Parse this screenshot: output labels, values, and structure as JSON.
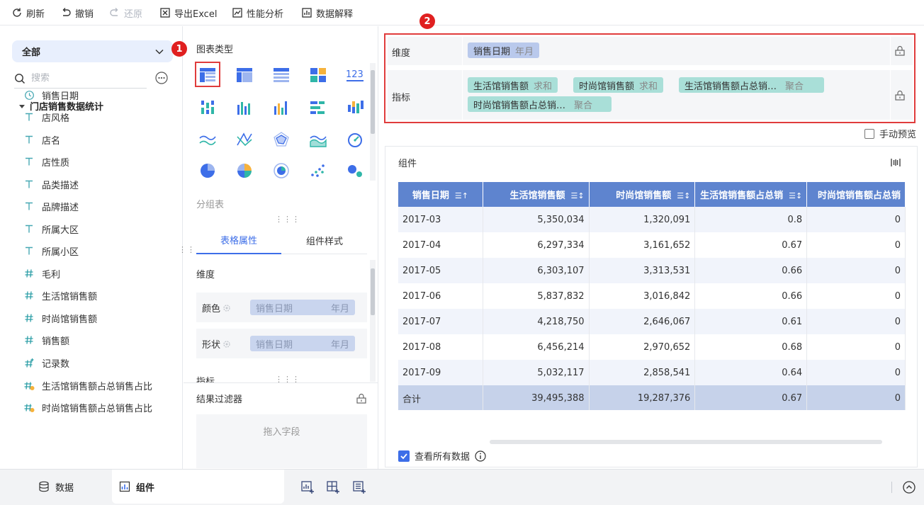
{
  "toolbar": {
    "refresh": "刷新",
    "undo": "撤销",
    "redo": "还原",
    "export_excel": "导出Excel",
    "performance": "性能分析",
    "data_explain": "数据解释"
  },
  "left": {
    "scope": "全部",
    "search_placeholder": "搜索",
    "tree_root": "门店销售数据统计",
    "fields": [
      {
        "label": "销售日期",
        "type": "date"
      },
      {
        "label": "店风格",
        "type": "text"
      },
      {
        "label": "店名",
        "type": "text"
      },
      {
        "label": "店性质",
        "type": "text"
      },
      {
        "label": "品类描述",
        "type": "text"
      },
      {
        "label": "品牌描述",
        "type": "text"
      },
      {
        "label": "所属大区",
        "type": "text"
      },
      {
        "label": "所属小区",
        "type": "text"
      },
      {
        "label": "毛利",
        "type": "number"
      },
      {
        "label": "生活馆销售额",
        "type": "number"
      },
      {
        "label": "时尚馆销售额",
        "type": "number"
      },
      {
        "label": "销售额",
        "type": "number"
      },
      {
        "label": "记录数",
        "type": "count"
      },
      {
        "label": "生活馆销售额占总销售占比",
        "type": "calc"
      },
      {
        "label": "时尚馆销售额占总销售占比",
        "type": "calc"
      }
    ]
  },
  "middle": {
    "chart_type_title": "图表类型",
    "chart_type_name": "分组表",
    "tabs": [
      "表格属性",
      "组件样式"
    ],
    "dim_label": "维度",
    "color_label": "颜色",
    "shape_label": "形状",
    "color_chip": {
      "field": "销售日期",
      "gran": "年月"
    },
    "shape_chip": {
      "field": "销售日期",
      "gran": "年月"
    },
    "metric_label": "指标",
    "filter_title": "结果过滤器",
    "filter_drop": "拖入字段"
  },
  "markers": {
    "one": "1",
    "two": "2"
  },
  "config": {
    "dim_label": "维度",
    "metric_label": "指标",
    "dim_pill": {
      "field": "销售日期",
      "agg": "年月"
    },
    "metric_pills": [
      {
        "field": "生活馆销售额",
        "agg": "求和"
      },
      {
        "field": "时尚馆销售额",
        "agg": "求和"
      },
      {
        "field": "生活馆销售额占总销…",
        "agg": "聚合"
      },
      {
        "field": "时尚馆销售额占总销…",
        "agg": "聚合"
      }
    ],
    "manual_preview": "手动预览"
  },
  "component": {
    "title": "组件",
    "headers": [
      "销售日期",
      "生活馆销售额",
      "时尚馆销售额",
      "生活馆销售额占总销",
      "时尚馆销售额占总销"
    ],
    "rows": [
      [
        "2017-03",
        "5,350,034",
        "1,320,091",
        "0.8",
        "0"
      ],
      [
        "2017-04",
        "6,297,334",
        "3,161,652",
        "0.67",
        "0"
      ],
      [
        "2017-05",
        "6,303,107",
        "3,313,531",
        "0.66",
        "0"
      ],
      [
        "2017-06",
        "5,837,832",
        "3,016,842",
        "0.66",
        "0"
      ],
      [
        "2017-07",
        "4,218,750",
        "2,646,067",
        "0.61",
        "0"
      ],
      [
        "2017-08",
        "6,456,214",
        "2,970,652",
        "0.68",
        "0"
      ],
      [
        "2017-09",
        "5,032,117",
        "2,858,541",
        "0.64",
        "0"
      ]
    ],
    "total": [
      "合计",
      "39,495,388",
      "19,287,376",
      "0.67",
      "0"
    ],
    "view_all": "查看所有数据"
  },
  "bottom": {
    "data_tab": "数据",
    "component_tab": "组件"
  },
  "colors": {
    "accent": "#3d6ee8",
    "header_bg": "#5e84cf",
    "highlight": "#e03c3c"
  }
}
